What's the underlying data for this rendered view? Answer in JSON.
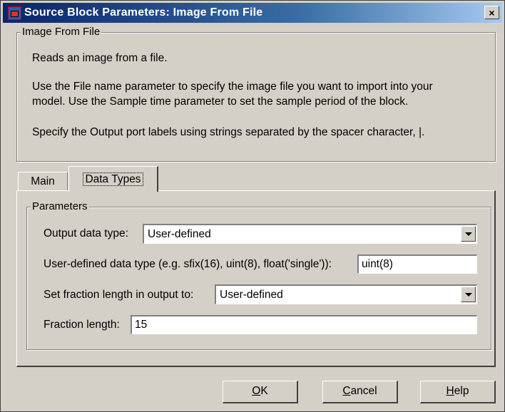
{
  "window": {
    "title": "Source Block Parameters: Image From File",
    "close_label": "×"
  },
  "description": {
    "group_title": "Image From File",
    "line1": "Reads an image from a file.",
    "line2": "Use the File name parameter to specify the image file you want to import into your",
    "line3": "model. Use the Sample time parameter to set the sample period of the block.",
    "line4": "Specify the Output port labels using strings separated by the spacer character, |."
  },
  "tabs": [
    {
      "label": "Main",
      "selected": false
    },
    {
      "label": "Data Types",
      "selected": true
    }
  ],
  "parameters": {
    "group_title": "Parameters",
    "output_data_type_label": "Output data type:",
    "output_data_type_value": "User-defined",
    "user_defined_label": "User-defined data type (e.g. sfix(16), uint(8), float('single')):",
    "user_defined_value": "uint(8)",
    "fraction_mode_label": "Set fraction length in output to:",
    "fraction_mode_value": "User-defined",
    "fraction_length_label": "Fraction length:",
    "fraction_length_value": "15"
  },
  "buttons": {
    "ok_mnemonic": "O",
    "ok_rest": "K",
    "cancel_mnemonic": "C",
    "cancel_rest": "ancel",
    "help_mnemonic": "H",
    "help_rest": "elp"
  },
  "colors": {
    "title_gradient_start": "#0a246a",
    "title_gradient_end": "#a6caf0",
    "face": "#d4d0c8"
  }
}
